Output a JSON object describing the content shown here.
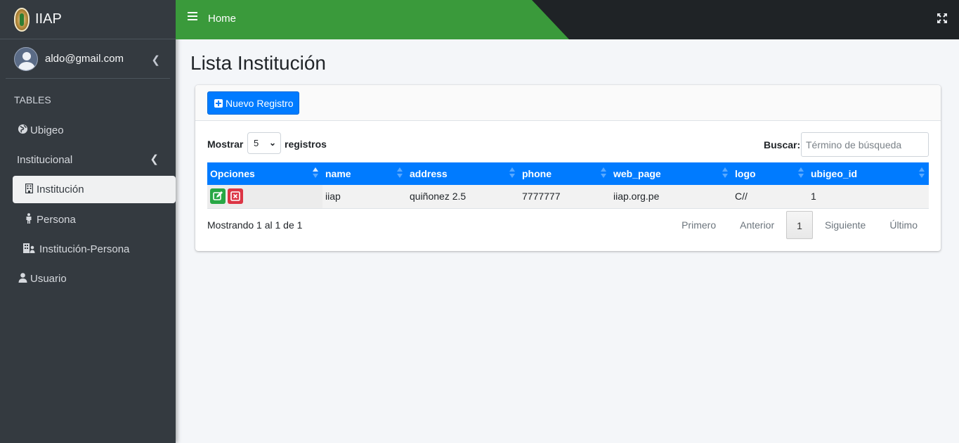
{
  "brand": {
    "name": "IIAP"
  },
  "user": {
    "email": "aldo@gmail.com"
  },
  "sidebar": {
    "header": "TABLES",
    "items": [
      {
        "label": "Ubigeo",
        "icon": "globe-icon"
      },
      {
        "label": "Institucional",
        "icon": ""
      },
      {
        "label": "Institución",
        "icon": "building-icon"
      },
      {
        "label": "Persona",
        "icon": "person-icon"
      },
      {
        "label": "Institución-Persona",
        "icon": "users-building-icon"
      },
      {
        "label": "Usuario",
        "icon": "user-icon"
      }
    ]
  },
  "topbar": {
    "home": "Home"
  },
  "page": {
    "title": "Lista Institución"
  },
  "card": {
    "new_button": "Nuevo Registro",
    "show_label": "Mostrar",
    "show_value": "5",
    "show_after": "registros",
    "search_label": "Buscar:",
    "search_placeholder": "Término de búsqueda"
  },
  "table": {
    "headers": [
      "Opciones",
      "name",
      "address",
      "phone",
      "web_page",
      "logo",
      "ubigeo_id"
    ],
    "rows": [
      {
        "name": "iiap",
        "address": "quiñonez 2.5",
        "phone": "7777777",
        "web_page": "iiap.org.pe",
        "logo": "C//",
        "ubigeo_id": "1"
      }
    ]
  },
  "footer": {
    "info": "Mostrando 1 al 1 de 1",
    "pager": {
      "first": "Primero",
      "prev": "Anterior",
      "current": "1",
      "next": "Siguiente",
      "last": "Último"
    }
  },
  "colors": {
    "accent": "#007bff",
    "navbar_green": "#3a9a3b",
    "sidebar": "#343a40",
    "edit": "#28a745",
    "delete": "#dc3545"
  }
}
